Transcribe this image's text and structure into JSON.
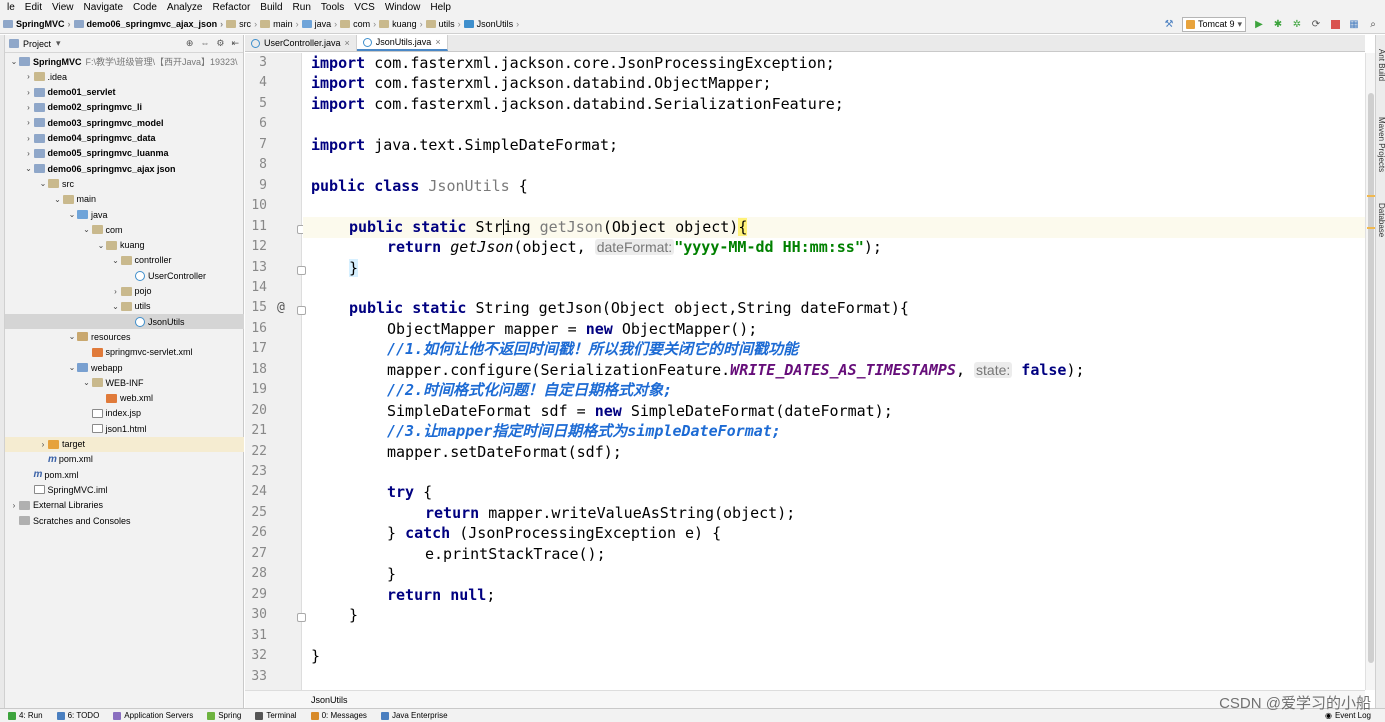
{
  "menu": [
    "le",
    "Edit",
    "View",
    "Navigate",
    "Code",
    "Analyze",
    "Refactor",
    "Build",
    "Run",
    "Tools",
    "VCS",
    "Window",
    "Help"
  ],
  "breadcrumbs": [
    {
      "label": "SpringMVC",
      "bold": true,
      "color": "#8fa7c9"
    },
    {
      "label": "demo06_springmvc_ajax_json",
      "bold": true,
      "color": "#8fa7c9"
    },
    {
      "label": "src",
      "bold": false,
      "color": "#c9b98d"
    },
    {
      "label": "main",
      "bold": false,
      "color": "#c9b98d"
    },
    {
      "label": "java",
      "bold": false,
      "color": "#6fa4d9"
    },
    {
      "label": "com",
      "bold": false,
      "color": "#c9b98d"
    },
    {
      "label": "kuang",
      "bold": false,
      "color": "#c9b98d"
    },
    {
      "label": "utils",
      "bold": false,
      "color": "#c9b98d"
    },
    {
      "label": "JsonUtils",
      "bold": false,
      "color": "#3f8fcc"
    }
  ],
  "run_config": {
    "label": "Tomcat 9"
  },
  "project_panel": {
    "title": "Project",
    "tree": [
      {
        "depth": 0,
        "arrow": "▾",
        "icon": "mod",
        "label": "SpringMVC",
        "bold": true,
        "extra": "F:\\教学\\班级管理\\【西开Java】19323\\"
      },
      {
        "depth": 1,
        "arrow": "›",
        "icon": "folder",
        "label": ".idea",
        "bold": false,
        "extra": ""
      },
      {
        "depth": 1,
        "arrow": "›",
        "icon": "mod",
        "label": "demo01_servlet",
        "bold": true,
        "extra": ""
      },
      {
        "depth": 1,
        "arrow": "›",
        "icon": "mod",
        "label": "demo02_springmvc_li",
        "bold": true,
        "extra": ""
      },
      {
        "depth": 1,
        "arrow": "›",
        "icon": "mod",
        "label": "demo03_springmvc_model",
        "bold": true,
        "extra": ""
      },
      {
        "depth": 1,
        "arrow": "›",
        "icon": "mod",
        "label": "demo04_springmvc_data",
        "bold": true,
        "extra": ""
      },
      {
        "depth": 1,
        "arrow": "›",
        "icon": "mod",
        "label": "demo05_springmvc_luanma",
        "bold": true,
        "extra": ""
      },
      {
        "depth": 1,
        "arrow": "▾",
        "icon": "mod",
        "label": "demo06_springmvc_ajax json",
        "bold": true,
        "extra": ""
      },
      {
        "depth": 2,
        "arrow": "▾",
        "icon": "folder",
        "label": "src",
        "bold": false,
        "extra": ""
      },
      {
        "depth": 3,
        "arrow": "▾",
        "icon": "folder",
        "label": "main",
        "bold": false,
        "extra": ""
      },
      {
        "depth": 4,
        "arrow": "▾",
        "icon": "src",
        "label": "java",
        "bold": false,
        "extra": ""
      },
      {
        "depth": 5,
        "arrow": "▾",
        "icon": "folder",
        "label": "com",
        "bold": false,
        "extra": ""
      },
      {
        "depth": 6,
        "arrow": "▾",
        "icon": "folder",
        "label": "kuang",
        "bold": false,
        "extra": ""
      },
      {
        "depth": 7,
        "arrow": "▾",
        "icon": "folder",
        "label": "controller",
        "bold": false,
        "extra": ""
      },
      {
        "depth": 8,
        "arrow": "",
        "icon": "cls",
        "label": "UserController",
        "bold": false,
        "extra": ""
      },
      {
        "depth": 7,
        "arrow": "›",
        "icon": "folder",
        "label": "pojo",
        "bold": false,
        "extra": ""
      },
      {
        "depth": 7,
        "arrow": "▾",
        "icon": "folder",
        "label": "utils",
        "bold": false,
        "extra": ""
      },
      {
        "depth": 8,
        "arrow": "",
        "icon": "cls",
        "label": "JsonUtils",
        "bold": false,
        "extra": "",
        "selected": true
      },
      {
        "depth": 4,
        "arrow": "▾",
        "icon": "res",
        "label": "resources",
        "bold": false,
        "extra": ""
      },
      {
        "depth": 5,
        "arrow": "",
        "icon": "xml",
        "label": "springmvc-servlet.xml",
        "bold": false,
        "extra": ""
      },
      {
        "depth": 4,
        "arrow": "▾",
        "icon": "web",
        "label": "webapp",
        "bold": false,
        "extra": ""
      },
      {
        "depth": 5,
        "arrow": "▾",
        "icon": "folder",
        "label": "WEB-INF",
        "bold": false,
        "extra": ""
      },
      {
        "depth": 6,
        "arrow": "",
        "icon": "xml",
        "label": "web.xml",
        "bold": false,
        "extra": ""
      },
      {
        "depth": 5,
        "arrow": "",
        "icon": "file",
        "label": "index.jsp",
        "bold": false,
        "extra": ""
      },
      {
        "depth": 5,
        "arrow": "",
        "icon": "file",
        "label": "json1.html",
        "bold": false,
        "extra": ""
      },
      {
        "depth": 2,
        "arrow": "›",
        "icon": "target",
        "label": "target",
        "bold": false,
        "extra": "",
        "highlight": true
      },
      {
        "depth": 2,
        "arrow": "",
        "icon": "file",
        "label": "pom.xml",
        "bold": false,
        "extra": "",
        "prefix": "m"
      },
      {
        "depth": 1,
        "arrow": "",
        "icon": "file",
        "label": "pom.xml",
        "bold": false,
        "extra": "",
        "prefix": "m"
      },
      {
        "depth": 1,
        "arrow": "",
        "icon": "file",
        "label": "SpringMVC.iml",
        "bold": false,
        "extra": ""
      },
      {
        "depth": 0,
        "arrow": "›",
        "icon": "lib",
        "label": "External Libraries",
        "bold": false,
        "extra": ""
      },
      {
        "depth": 0,
        "arrow": "",
        "icon": "lib",
        "label": "Scratches and Consoles",
        "bold": false,
        "extra": ""
      }
    ]
  },
  "tabs": [
    {
      "label": "UserController.java",
      "active": false
    },
    {
      "label": "JsonUtils.java",
      "active": true
    }
  ],
  "editor": {
    "footer_label": "JsonUtils",
    "line_numbers": [
      "3",
      "4",
      "5",
      "6",
      "7",
      "8",
      "9",
      "10",
      "11",
      "12",
      "13",
      "14",
      "15",
      "16",
      "17",
      "18",
      "19",
      "20",
      "21",
      "22",
      "23",
      "24",
      "25",
      "26",
      "27",
      "28",
      "29",
      "30",
      "31",
      "32",
      "33"
    ],
    "line_3": "com.fasterxml.jackson.core.JsonProcessingException;",
    "line_4": "com.fasterxml.jackson.databind.ObjectMapper;",
    "line_5": "com.fasterxml.jackson.databind.SerializationFeature;",
    "line_7": "java.text.SimpleDateFormat;",
    "kw_import": "import",
    "kw_public": "public",
    "kw_class": "class",
    "kw_static": "static",
    "kw_return": "return",
    "kw_new": "new",
    "kw_try": "try",
    "kw_catch": "catch",
    "kw_false": "false",
    "kw_null": "null",
    "class_name": "JsonUtils",
    "brace_open": "{",
    "brace_close": "}",
    "l11_type_a": "Str",
    "l11_type_b": "ing",
    "l11_name": "getJson",
    "l11_params": "(Object object)",
    "l12_call": "getJson",
    "l12_args": "(object,",
    "hint_dateformat": "dateFormat:",
    "l12_string": "\"yyyy-MM-dd HH:mm:ss\"",
    "l12_end": ");",
    "l15_sig": "String getJson(Object object,String dateFormat){",
    "l16_a": "ObjectMapper mapper = ",
    "l16_b": "ObjectMapper();",
    "l17_comment": "//1.如何让他不返回时间戳！所以我们要关闭它的时间戳功能",
    "l18_a": "mapper.configure(SerializationFeature.",
    "l18_const": "WRITE_DATES_AS_TIMESTAMPS",
    "l18_comma": ",",
    "hint_state": "state:",
    "l18_end": ");",
    "l19_comment": "//2.时间格式化问题！自定日期格式对象;",
    "l20_a": "SimpleDateFormat sdf = ",
    "l20_b": "SimpleDateFormat(dateFormat);",
    "l21_comment": "//3.让mapper指定时间日期格式为simpleDateFormat;",
    "l22": "mapper.setDateFormat(sdf);",
    "l24_b": " {",
    "l25_b": "mapper.writeValueAsString(object);",
    "l26_a": "} ",
    "l26_b": " (JsonProcessingException e) {",
    "l27": "e.printStackTrace();",
    "semicolon": ";",
    "gutter_at": "@"
  },
  "right_strip": [
    "Ant Build",
    "Maven Projects",
    "Database"
  ],
  "bottom_bar": [
    {
      "label": "4: Run",
      "color": "#3ca33c"
    },
    {
      "label": "6: TODO",
      "color": "#4a7fc0"
    },
    {
      "label": "Application Servers",
      "color": "#8a6fc0"
    },
    {
      "label": "Spring",
      "color": "#6db33f"
    },
    {
      "label": "Terminal",
      "color": "#555555"
    },
    {
      "label": "0: Messages",
      "color": "#d88b2a"
    },
    {
      "label": "Java Enterprise",
      "color": "#4a7fc0"
    }
  ],
  "event_log": "Event Log",
  "watermark": "CSDN @爱学习的小船"
}
